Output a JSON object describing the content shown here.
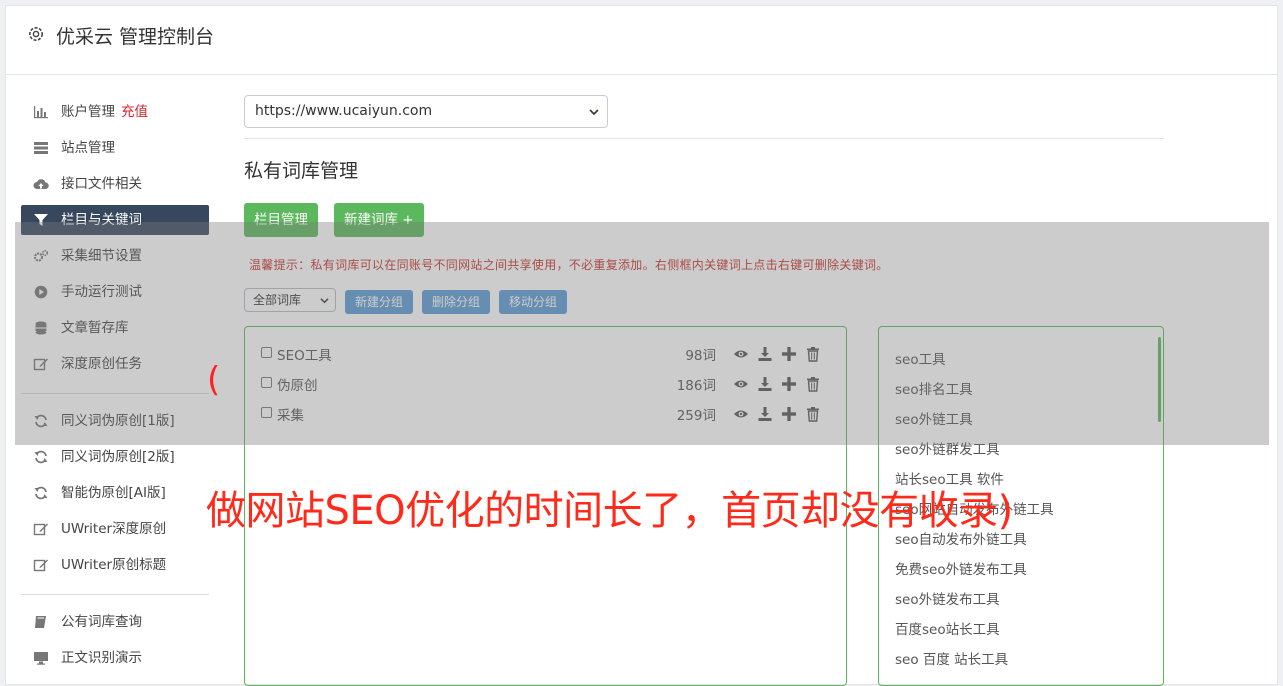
{
  "header": {
    "title": "优采云 管理控制台",
    "icon": "gear-icon"
  },
  "sidebar": {
    "items": [
      {
        "label": "账户管理",
        "badge": "充值",
        "icon": "bar-chart-icon"
      },
      {
        "label": "站点管理",
        "icon": "server-icon"
      },
      {
        "label": "接口文件相关",
        "icon": "cloud-upload-icon"
      },
      {
        "label": "栏目与关键词",
        "icon": "filter-icon",
        "active": true
      },
      {
        "label": "采集细节设置",
        "icon": "cogs-icon"
      },
      {
        "label": "手动运行测试",
        "icon": "play-circle-icon"
      },
      {
        "label": "文章暂存库",
        "icon": "database-icon"
      },
      {
        "label": "深度原创任务",
        "icon": "edit-icon"
      },
      {
        "label": "同义词伪原创[1版]",
        "icon": "refresh-icon"
      },
      {
        "label": "同义词伪原创[2版]",
        "icon": "refresh-icon"
      },
      {
        "label": "智能伪原创[AI版]",
        "icon": "refresh-icon"
      },
      {
        "label": "UWriter深度原创",
        "icon": "edit-icon"
      },
      {
        "label": "UWriter原创标题",
        "icon": "edit-icon"
      },
      {
        "label": "公有词库查询",
        "icon": "book-icon"
      },
      {
        "label": "正文识别演示",
        "icon": "monitor-icon"
      }
    ]
  },
  "main": {
    "site_select": "https://www.ucaiyun.com",
    "section_title": "私有词库管理",
    "buttons": {
      "column_manage": "栏目管理",
      "new_library": "新建词库 +"
    },
    "tip": "温馨提示：私有词库可以在同账号不同网站之间共享使用，不必重复添加。右侧框内关键词上点击右键可删除关键词。",
    "library_filter": "全部词库",
    "group_buttons": {
      "new_group": "新建分组",
      "delete_group": "删除分组",
      "move_group": "移动分组"
    },
    "libraries": [
      {
        "name": "SEO工具",
        "count": "98词"
      },
      {
        "name": "伪原创",
        "count": "186词"
      },
      {
        "name": "采集",
        "count": "259词"
      }
    ],
    "keywords": [
      "seo工具",
      "seo排名工具",
      "seo外链工具",
      "seo外链群发工具",
      "站长seo工具 软件",
      "seo网站自动发布外链工具",
      "seo自动发布外链工具",
      "免费seo外链发布工具",
      "seo外链发布工具",
      "百度seo站长工具",
      "seo 百度 站长工具"
    ]
  },
  "overlay": {
    "paren": "(",
    "caption": "做网站SEO优化的时间长了，首页却没有收录)"
  },
  "colors": {
    "accent_green": "#5cb85c",
    "accent_blue": "#5b9bd5",
    "sidebar_active": "#37475e",
    "tip_red": "#c9302c"
  }
}
